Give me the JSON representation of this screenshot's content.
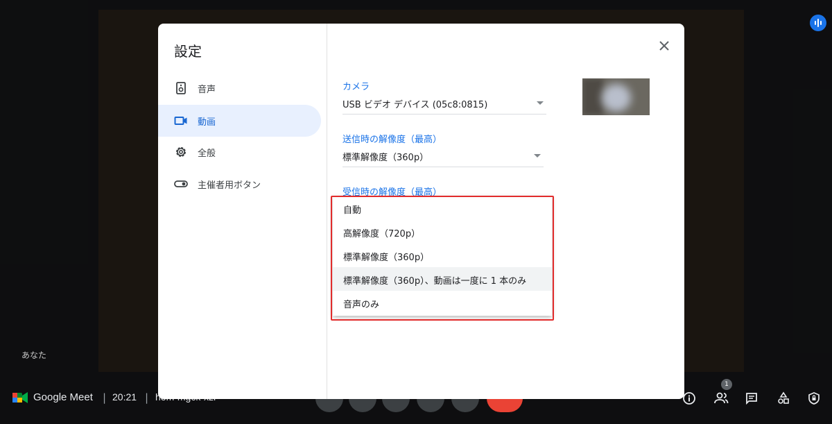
{
  "background": {
    "participant_label": "あなた"
  },
  "bottom_bar": {
    "app_name": "Google Meet",
    "separator": "|",
    "time": "20:21",
    "meeting_code": "hom-mgck-xzi",
    "people_count": "1",
    "icons": [
      "info-icon",
      "people-icon",
      "chat-icon",
      "activities-icon",
      "host-controls-icon"
    ]
  },
  "dialog": {
    "title": "設定",
    "nav": [
      {
        "label": "音声",
        "icon": "speaker-icon",
        "active": false
      },
      {
        "label": "動画",
        "icon": "videocam-icon",
        "active": true
      },
      {
        "label": "全般",
        "icon": "gear-icon",
        "active": false
      },
      {
        "label": "主催者用ボタン",
        "icon": "toggle-icon",
        "active": false
      }
    ],
    "camera": {
      "label": "カメラ",
      "value": "USB ビデオ デバイス (05c8:0815)"
    },
    "send_resolution": {
      "label": "送信時の解像度（最高）",
      "value": "標準解像度（360p）"
    },
    "receive_resolution": {
      "label": "受信時の解像度（最高）",
      "options": [
        "自動",
        "高解像度（720p）",
        "標準解像度（360p）",
        "標準解像度（360p）、動画は一度に 1 本のみ",
        "音声のみ"
      ],
      "hovered_index": 3
    }
  },
  "colors": {
    "accent": "#1a73e8",
    "highlight_box": "#e22c2c",
    "end_call": "#ea4335"
  }
}
